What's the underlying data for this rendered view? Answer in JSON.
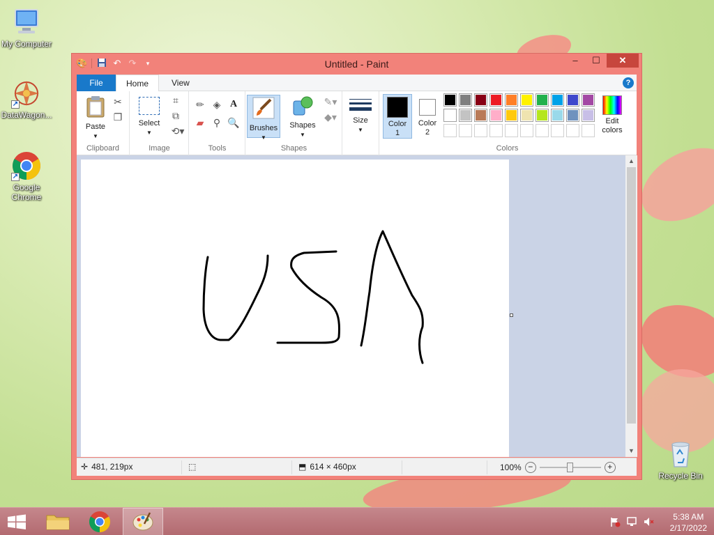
{
  "desktop": {
    "icons": [
      {
        "label": "My Computer"
      },
      {
        "label": "DataWagon..."
      },
      {
        "label": "Google Chrome"
      },
      {
        "label": "Recycle Bin"
      }
    ]
  },
  "window": {
    "title": "Untitled - Paint",
    "buttons": {
      "minimize": "–",
      "maximize": "☐",
      "close": "✕"
    }
  },
  "tabs": {
    "file": "File",
    "home": "Home",
    "view": "View"
  },
  "ribbon": {
    "clipboard": {
      "label": "Clipboard",
      "paste": "Paste"
    },
    "image": {
      "label": "Image",
      "select": "Select"
    },
    "tools": {
      "label": "Tools"
    },
    "brushes": {
      "label": "Brushes"
    },
    "shapes": {
      "label": "Shapes",
      "shapes_btn": "Shapes"
    },
    "size": {
      "label": "Size"
    },
    "colors": {
      "label": "Colors",
      "color1": "Color",
      "color1_num": "1",
      "color2": "Color",
      "color2_num": "2",
      "edit": "Edit",
      "edit2": "colors",
      "color1_value": "#000000",
      "color2_value": "#ffffff",
      "row1": [
        "#000000",
        "#7f7f7f",
        "#880015",
        "#ed1c24",
        "#ff7f27",
        "#fff200",
        "#22b14c",
        "#00a2e8",
        "#3f48cc",
        "#a349a4"
      ],
      "row2": [
        "#ffffff",
        "#c3c3c3",
        "#b97a57",
        "#ffaec9",
        "#ffc90e",
        "#efe4b0",
        "#b5e61d",
        "#99d9ea",
        "#7092be",
        "#c8bfe7"
      ],
      "row3": [
        "#ffffff",
        "#ffffff",
        "#ffffff",
        "#ffffff",
        "#ffffff",
        "#ffffff",
        "#ffffff",
        "#ffffff",
        "#ffffff",
        "#ffffff"
      ]
    }
  },
  "status": {
    "cursor": "481, 219px",
    "size": "614 × 460px",
    "zoom": "100%"
  },
  "taskbar": {
    "time": "5:38 AM",
    "date": "2/17/2022"
  }
}
